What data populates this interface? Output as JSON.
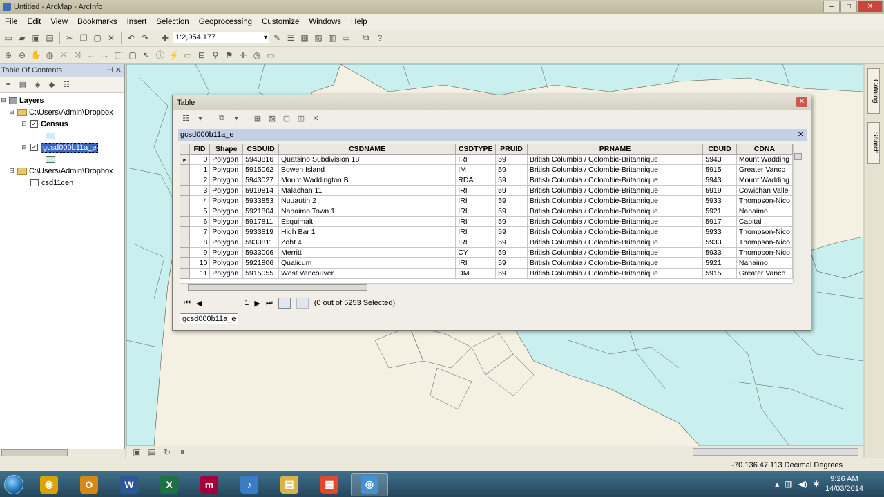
{
  "window": {
    "title": "Untitled - ArcMap - ArcInfo",
    "minimize": "–",
    "maximize": "□",
    "close": "✕"
  },
  "menu": [
    "File",
    "Edit",
    "View",
    "Bookmarks",
    "Insert",
    "Selection",
    "Geoprocessing",
    "Customize",
    "Windows",
    "Help"
  ],
  "toolbar": {
    "scale": "1:2,954,177"
  },
  "toc": {
    "title": "Table Of Contents",
    "pin": "⊣ ✕",
    "layers_label": "Layers",
    "folder1": "C:\\Users\\Admin\\Dropbox",
    "census": "Census",
    "selected_layer": "gcsd000b11a_e",
    "folder2": "C:\\Users\\Admin\\Dropbox",
    "table": "csd11cen"
  },
  "side_tabs": {
    "catalog": "Catalog",
    "search": "Search"
  },
  "status": {
    "coords": "-70.136  47.113 Decimal Degrees"
  },
  "table_window": {
    "title": "Table",
    "close": "✕",
    "tab_name": "gcsd000b11a_e",
    "tab_close": "✕",
    "columns": [
      "FID",
      "Shape",
      "CSDUID",
      "CSDNAME",
      "CSDTYPE",
      "PRUID",
      "PRNAME",
      "CDUID",
      "CDNA"
    ],
    "rows": [
      [
        "0",
        "Polygon",
        "5943816",
        "Quatsino Subdivision 18",
        "IRI",
        "59",
        "British Columbia / Colombie-Britannique",
        "5943",
        "Mount Wadding"
      ],
      [
        "1",
        "Polygon",
        "5915062",
        "Bowen Island",
        "IM",
        "59",
        "British Columbia / Colombie-Britannique",
        "5915",
        "Greater Vanco"
      ],
      [
        "2",
        "Polygon",
        "5943027",
        "Mount Waddington B",
        "RDA",
        "59",
        "British Columbia / Colombie-Britannique",
        "5943",
        "Mount Wadding"
      ],
      [
        "3",
        "Polygon",
        "5919814",
        "Malachan 11",
        "IRI",
        "59",
        "British Columbia / Colombie-Britannique",
        "5919",
        "Cowichan Valle"
      ],
      [
        "4",
        "Polygon",
        "5933853",
        "Nuuautin 2",
        "IRI",
        "59",
        "British Columbia / Colombie-Britannique",
        "5933",
        "Thompson-Nico"
      ],
      [
        "5",
        "Polygon",
        "5921804",
        "Nanaimo Town 1",
        "IRI",
        "59",
        "British Columbia / Colombie-Britannique",
        "5921",
        "Nanaimo"
      ],
      [
        "6",
        "Polygon",
        "5917811",
        "Esquimalt",
        "IRI",
        "59",
        "British Columbia / Colombie-Britannique",
        "5917",
        "Capital"
      ],
      [
        "7",
        "Polygon",
        "5933819",
        "High Bar 1",
        "IRI",
        "59",
        "British Columbia / Colombie-Britannique",
        "5933",
        "Thompson-Nico"
      ],
      [
        "8",
        "Polygon",
        "5933811",
        "Zoht 4",
        "IRI",
        "59",
        "British Columbia / Colombie-Britannique",
        "5933",
        "Thompson-Nico"
      ],
      [
        "9",
        "Polygon",
        "5933006",
        "Merritt",
        "CY",
        "59",
        "British Columbia / Colombie-Britannique",
        "5933",
        "Thompson-Nico"
      ],
      [
        "10",
        "Polygon",
        "5921806",
        "Qualicum",
        "IRI",
        "59",
        "British Columbia / Colombie-Britannique",
        "5921",
        "Nanaimo"
      ],
      [
        "11",
        "Polygon",
        "5915055",
        "West Vancouver",
        "DM",
        "59",
        "British Columbia / Colombie-Britannique",
        "5915",
        "Greater Vanco"
      ]
    ],
    "nav": {
      "first": "⏮",
      "prev": "◀",
      "page": "1",
      "next": "▶",
      "last": "⏭",
      "selection": "(0 out of 5253 Selected)"
    },
    "bottom_tab": "gcsd000b11a_e"
  },
  "taskbar": {
    "apps": [
      {
        "name": "chrome",
        "glyph": "◉",
        "color": "#d9a400"
      },
      {
        "name": "outlook",
        "glyph": "O",
        "color": "#d48a12"
      },
      {
        "name": "word",
        "glyph": "W",
        "color": "#2b5797"
      },
      {
        "name": "excel",
        "glyph": "X",
        "color": "#1e7145"
      },
      {
        "name": "mendeley",
        "glyph": "m",
        "color": "#a3003b"
      },
      {
        "name": "itunes",
        "glyph": "♪",
        "color": "#3b7dc4"
      },
      {
        "name": "explorer",
        "glyph": "▤",
        "color": "#d8b54a"
      },
      {
        "name": "apps",
        "glyph": "▦",
        "color": "#e04a2a"
      },
      {
        "name": "arcmap",
        "glyph": "◎",
        "color": "#4a8fd0"
      }
    ],
    "time": "9:26 AM",
    "date": "14/03/2014"
  }
}
